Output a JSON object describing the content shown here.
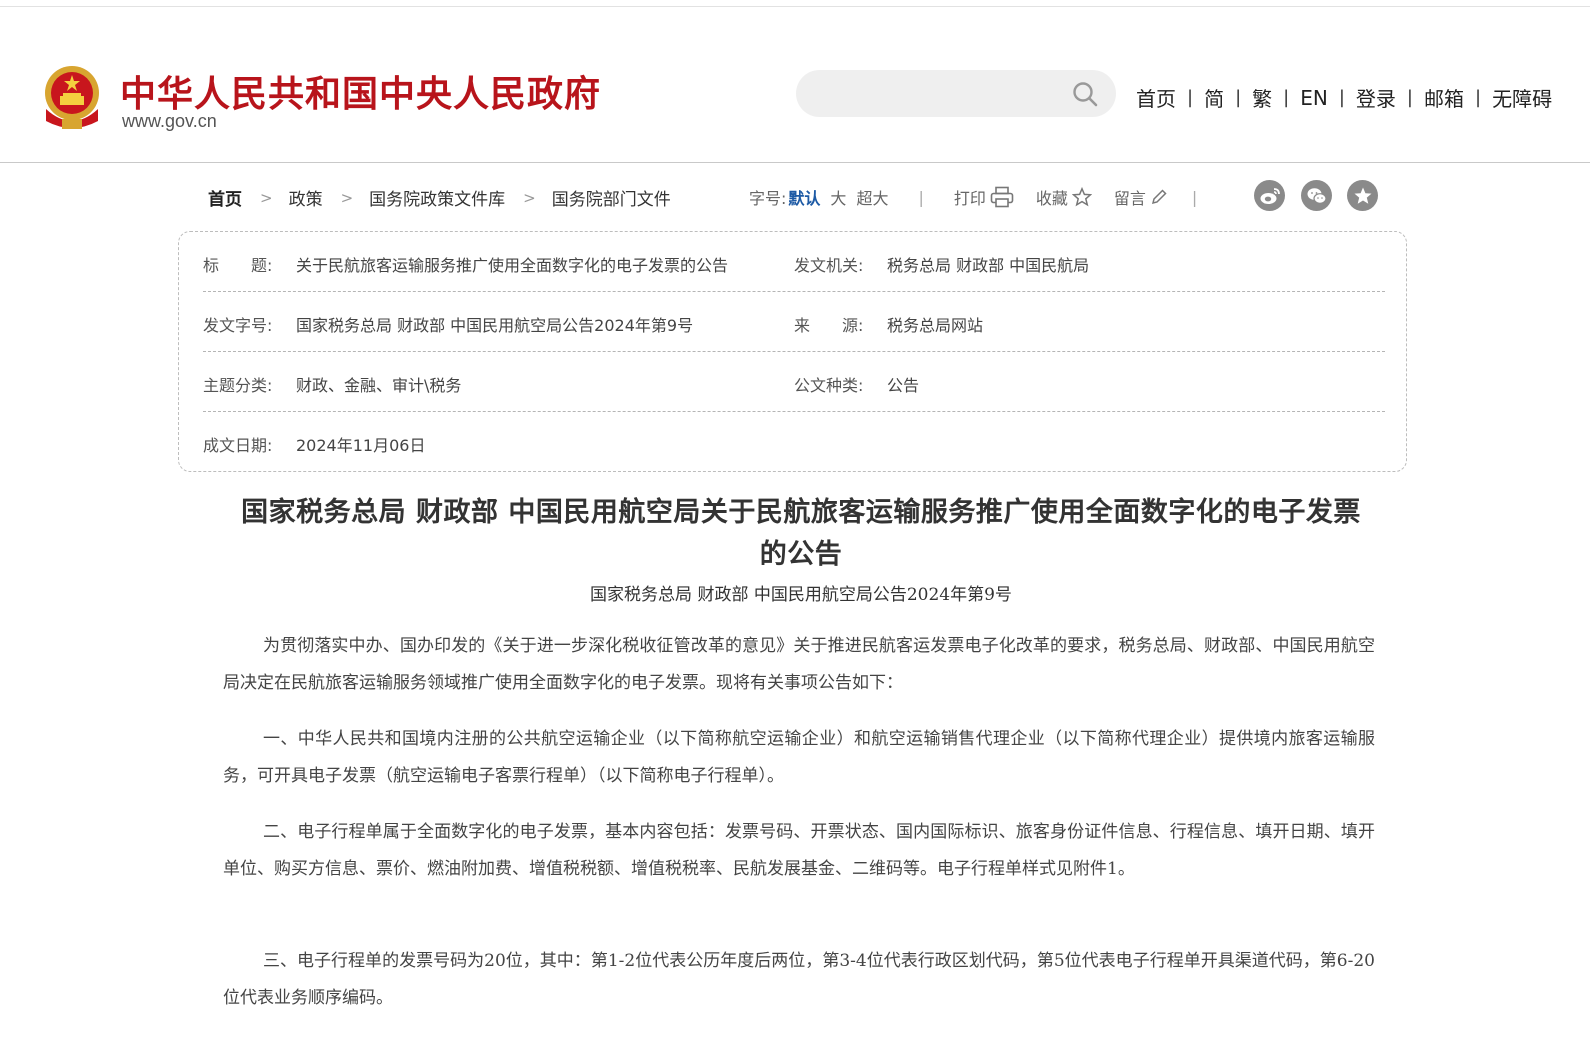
{
  "header": {
    "site_title": "中华人民共和国中央人民政府",
    "site_domain": "www.gov.cn",
    "search_placeholder": "",
    "nav": [
      "首页",
      "简",
      "繁",
      "EN",
      "登录",
      "邮箱",
      "无障碍"
    ]
  },
  "breadcrumb": [
    "首页",
    "政策",
    "国务院政策文件库",
    "国务院部门文件"
  ],
  "tools": {
    "font_size_label": "字号:",
    "font_sizes": [
      "默认",
      "大",
      "超大"
    ],
    "print": "打印",
    "favorite": "收藏",
    "comment": "留言"
  },
  "share_icons": [
    "weibo-icon",
    "wechat-icon",
    "favorite-star-icon"
  ],
  "info": {
    "title_label": "标　　题:",
    "title_value": "关于民航旅客运输服务推广使用全面数字化的电子发票的公告",
    "issuer_label": "发文机关:",
    "issuer_value": "税务总局  财政部  中国民航局",
    "doc_no_label": "发文字号:",
    "doc_no_value": "国家税务总局  财政部  中国民用航空局公告2024年第9号",
    "source_label": "来　　源:",
    "source_value": "税务总局网站",
    "category_label": "主题分类:",
    "category_value": "财政、金融、审计\\税务",
    "doc_type_label": "公文种类:",
    "doc_type_value": "公告",
    "date_label": "成文日期:",
    "date_value": "2024年11月06日"
  },
  "article": {
    "title": "国家税务总局  财政部  中国民用航空局关于民航旅客运输服务推广使用全面数字化的电子发票的公告",
    "subtitle": "国家税务总局  财政部  中国民用航空局公告2024年第9号",
    "paragraphs": [
      "为贯彻落实中办、国办印发的《关于进一步深化税收征管改革的意见》关于推进民航客运发票电子化改革的要求，税务总局、财政部、中国民用航空局决定在民航旅客运输服务领域推广使用全面数字化的电子发票。现将有关事项公告如下：",
      "一、中华人民共和国境内注册的公共航空运输企业（以下简称航空运输企业）和航空运输销售代理企业（以下简称代理企业）提供境内旅客运输服务，可开具电子发票（航空运输电子客票行程单）（以下简称电子行程单）。",
      "二、电子行程单属于全面数字化的电子发票，基本内容包括：发票号码、开票状态、国内国际标识、旅客身份证件信息、行程信息、填开日期、填开单位、购买方信息、票价、燃油附加费、增值税税额、增值税税率、民航发展基金、二维码等。电子行程单样式见附件1。",
      "三、电子行程单的发票号码为20位，其中：第1-2位代表公历年度后两位，第3-4位代表行政区划代码，第5位代表电子行程单开具渠道代码，第6-20位代表业务顺序编码。"
    ]
  },
  "colors": {
    "brand_red": "#b8141b",
    "link_blue": "#1d5aa5"
  }
}
